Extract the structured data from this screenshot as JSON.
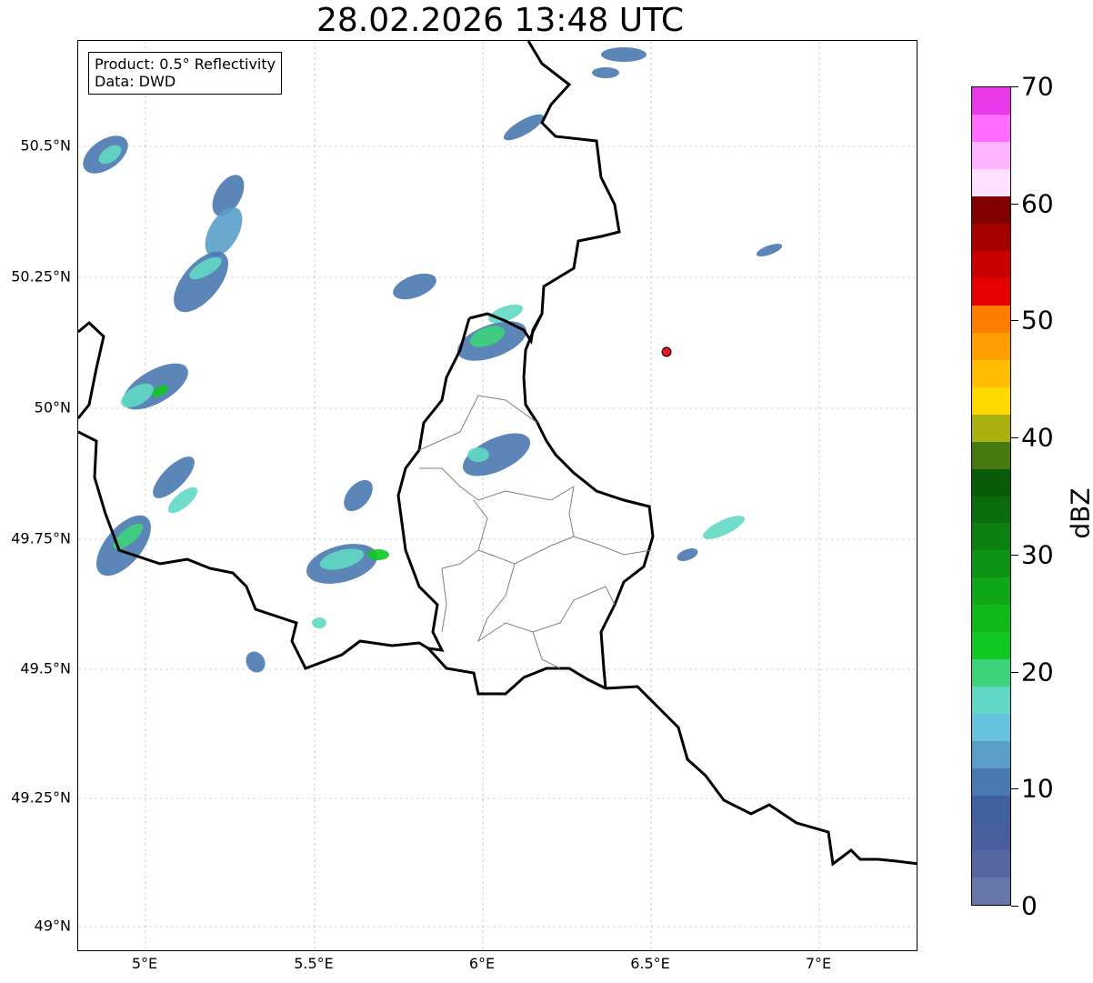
{
  "title": "28.02.2026 13:48 UTC",
  "info": {
    "line1": "Product: 0.5° Reflectivity",
    "line2": "Data: DWD"
  },
  "map": {
    "lat_labels": [
      "50.5°N",
      "50.25°N",
      "50°N",
      "49.75°N",
      "49.5°N",
      "49.25°N",
      "49°N"
    ],
    "lon_labels": [
      "5°E",
      "5.5°E",
      "6°E",
      "6.5°E",
      "7°E"
    ],
    "marker_color": "#e8141e",
    "border_color": "#000000",
    "admin_border_color": "#808080"
  },
  "colorbar": {
    "unit": "dBZ",
    "min": 0,
    "max": 70,
    "tick_labels": [
      "0",
      "10",
      "20",
      "30",
      "40",
      "50",
      "60",
      "70"
    ],
    "colors": [
      "#6677aa",
      "#5566a0",
      "#4a5e9e",
      "#4060a0",
      "#4a78b0",
      "#5a9ec8",
      "#66c2de",
      "#60d8c4",
      "#3cd47a",
      "#10c820",
      "#10b818",
      "#10a818",
      "#0e9414",
      "#0c8010",
      "#0a6c0c",
      "#085c08",
      "#467a10",
      "#aab010",
      "#ffd800",
      "#ffbc00",
      "#ff9e00",
      "#ff7c00",
      "#e60000",
      "#c80000",
      "#a60000",
      "#800000",
      "#ffe0ff",
      "#ffb4ff",
      "#ff6cff",
      "#e838e8"
    ]
  }
}
